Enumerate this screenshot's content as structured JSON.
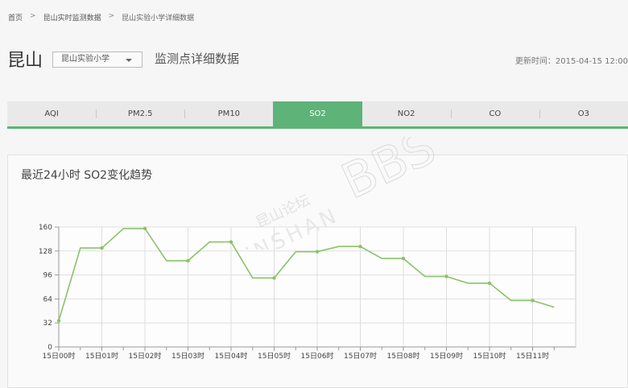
{
  "breadcrumb": {
    "home": "首页",
    "realtime": "昆山实时监测数据",
    "detail": "昆山实验小学详细数据"
  },
  "header": {
    "city": "昆山",
    "station": "昆山实验小学",
    "subtitle": "监测点详细数据",
    "updated_label": "更新时间：",
    "updated_value": "2015-04-15 12:00"
  },
  "tabs": [
    {
      "label": "AQI",
      "active": false
    },
    {
      "label": "PM2.5",
      "active": false
    },
    {
      "label": "PM10",
      "active": false
    },
    {
      "label": "SO2",
      "active": true
    },
    {
      "label": "NO2",
      "active": false
    },
    {
      "label": "CO",
      "active": false
    },
    {
      "label": "O3",
      "active": false
    }
  ],
  "watermark": {
    "line1": "昆山论坛",
    "line2": "KUNSHAN",
    "line3": "BBS"
  },
  "colors": {
    "accent": "#5db378",
    "line": "#8cc26a",
    "tab_bg": "#e9e9e9"
  },
  "chart_data": {
    "type": "line",
    "title": "最近24小时 SO2变化趋势",
    "ylim": [
      0,
      160
    ],
    "yticks": [
      0,
      32,
      64,
      96,
      128,
      160
    ],
    "xticks": [
      "15日00时",
      "15日01时",
      "15日02时",
      "15日03时",
      "15日04时",
      "15日05时",
      "15日06时",
      "15日07时",
      "15日08时",
      "15日09时",
      "15日10时",
      "15日11时"
    ],
    "grid": true,
    "series": [
      {
        "x": [
          0,
          0.5,
          1,
          1.5,
          2,
          2.5,
          3,
          3.5,
          4,
          4.5,
          5,
          5.5,
          6,
          6.5,
          7,
          7.5,
          8,
          8.5,
          9,
          9.5,
          10,
          10.5,
          11,
          11.5
        ],
        "values": [
          35,
          132,
          132,
          158,
          158,
          115,
          115,
          140,
          140,
          92,
          92,
          127,
          127,
          134,
          134,
          118,
          118,
          94,
          94,
          85,
          85,
          62,
          62,
          53
        ]
      }
    ]
  }
}
